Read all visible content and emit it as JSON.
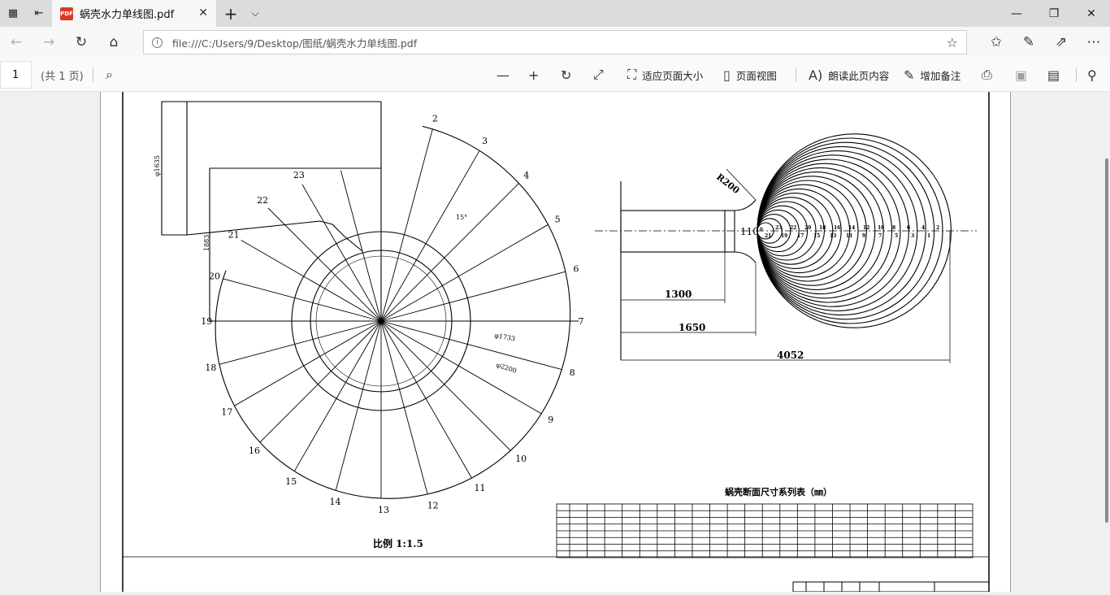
{
  "browser": {
    "tab_title": "蜗壳水力单线图.pdf",
    "url": "file:///C:/Users/9/Desktop/图纸/蜗壳水力单线图.pdf",
    "pdf_badge": "PDF"
  },
  "pdf_toolbar": {
    "page_number": "1",
    "page_total": "(共 1 页)",
    "fit_page": "适应页面大小",
    "page_view": "页面视图",
    "read_aloud": "朗读此页内容",
    "add_notes": "增加备注"
  },
  "drawing": {
    "spiral_labels": [
      "2",
      "3",
      "4",
      "5",
      "6",
      "7",
      "8",
      "9",
      "10",
      "11",
      "12",
      "13",
      "14",
      "15",
      "16",
      "17",
      "18",
      "19",
      "20",
      "21",
      "22",
      "23"
    ],
    "angle_label": "15°",
    "dia_inlet": "φ1635",
    "dim_1883": "1883",
    "dia_1733": "φ1733",
    "dia_2200": "φ2200",
    "scale_label": "比例 1:1.5",
    "r200": "R200",
    "angle_110": "110°",
    "dim_1300": "1300",
    "dim_1650": "1650",
    "dim_4052": "4052",
    "section_labels_top": [
      "23",
      "22",
      "20",
      "18",
      "16",
      "14",
      "12",
      "10",
      "8",
      "6",
      "4",
      "2"
    ],
    "section_labels_bottom": [
      "21",
      "19",
      "17",
      "15",
      "13",
      "11",
      "9",
      "7",
      "5",
      "3",
      "1"
    ],
    "table_title": "蜗壳断面尺寸系列表（㎜）"
  }
}
